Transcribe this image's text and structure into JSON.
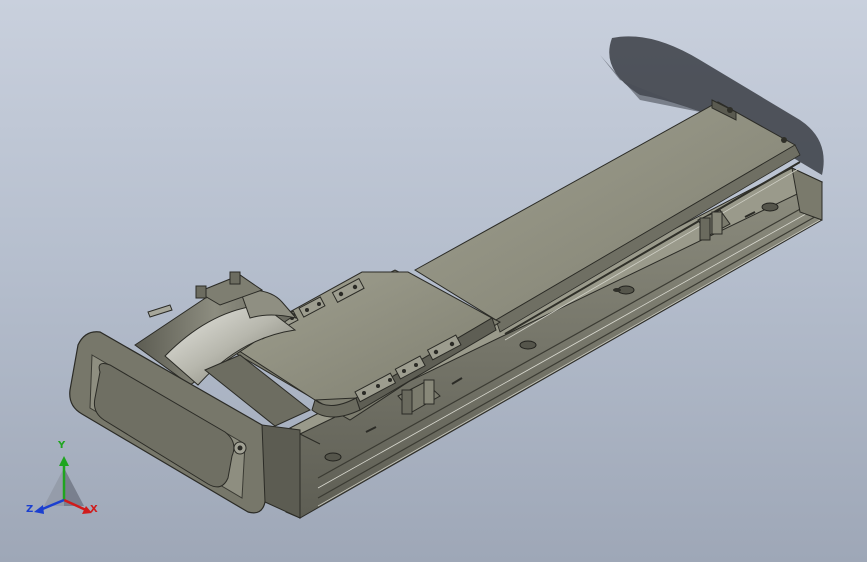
{
  "viewport": {
    "background_top": "#c9d0dd",
    "background_bottom": "#9ea7b7",
    "model_color": "#8a8a7a"
  },
  "triad": {
    "x_label": "X",
    "y_label": "Y",
    "z_label": "Z",
    "x_color": "#d01b1b",
    "y_color": "#1fa51f",
    "z_color": "#1b3fd0"
  }
}
